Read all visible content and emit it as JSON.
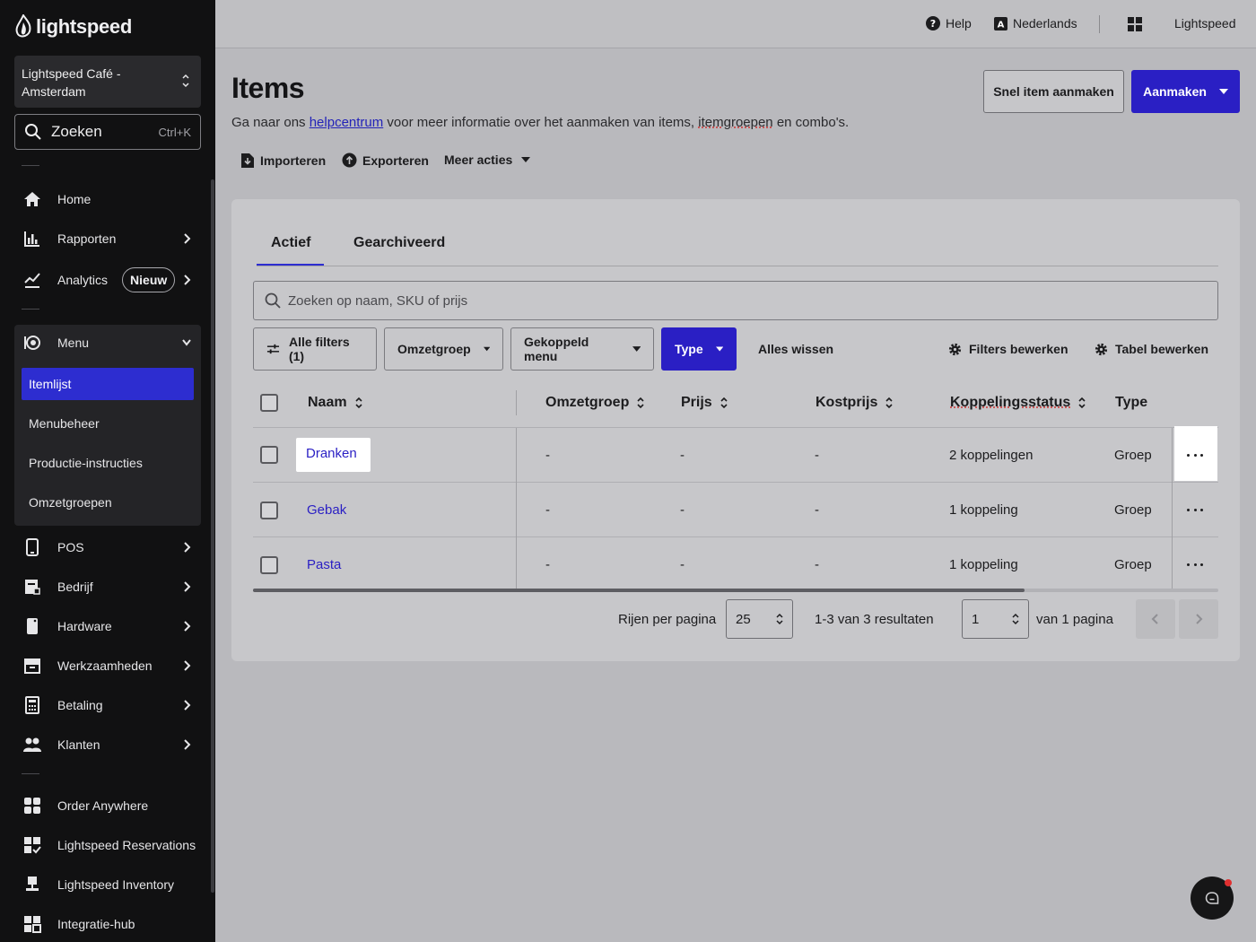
{
  "sidebar": {
    "brand": "lightspeed",
    "store": {
      "line1": "Lightspeed Café -",
      "line2": "Amsterdam"
    },
    "search": {
      "label": "Zoeken",
      "shortcut": "Ctrl+K"
    },
    "nav": {
      "home": "Home",
      "rapporten": "Rapporten",
      "analytics": "Analytics",
      "analytics_badge": "Nieuw",
      "menu": "Menu",
      "menu_items": [
        "Itemlijst",
        "Menubeheer",
        "Productie-instructies",
        "Omzetgroepen"
      ],
      "pos": "POS",
      "bedrijf": "Bedrijf",
      "hardware": "Hardware",
      "werkzaamheden": "Werkzaamheden",
      "betaling": "Betaling",
      "klanten": "Klanten",
      "order_anywhere": "Order Anywhere",
      "reservations": "Lightspeed Reservations",
      "inventory": "Lightspeed Inventory",
      "integratie": "Integratie-hub"
    },
    "active_item": "Itemlijst"
  },
  "topbar": {
    "help": "Help",
    "language": "Nederlands",
    "account": "Lightspeed"
  },
  "header": {
    "title": "Items",
    "subtitle_before": "Ga naar ons ",
    "subtitle_link": "helpcentrum",
    "subtitle_middle": " voor meer informatie over het aanmaken van items, ",
    "subtitle_groups": "itemgroepen",
    "subtitle_after": " en combo's.",
    "quick_create": "Snel item aanmaken",
    "create": "Aanmaken",
    "import": "Importeren",
    "export": "Exporteren",
    "more_actions": "Meer acties"
  },
  "tabs": {
    "active": "Actief",
    "archived": "Gearchiveerd"
  },
  "search": {
    "placeholder": "Zoeken op naam, SKU of prijs"
  },
  "filters": {
    "all": "Alle filters (1)",
    "revenue_group": "Omzetgroep",
    "linked_menu": "Gekoppeld menu",
    "type": "Type",
    "clear": "Alles wissen",
    "edit_filters": "Filters bewerken",
    "edit_table": "Tabel bewerken"
  },
  "table": {
    "columns": {
      "name": "Naam",
      "revenue_group": "Omzetgroep",
      "price": "Prijs",
      "cost": "Kostprijs",
      "link_status": "Koppelingsstatus",
      "type": "Type"
    },
    "rows": [
      {
        "name": "Dranken",
        "revenue_group": "-",
        "price": "-",
        "cost": "-",
        "link_status": "2 koppelingen",
        "type": "Groep"
      },
      {
        "name": "Gebak",
        "revenue_group": "-",
        "price": "-",
        "cost": "-",
        "link_status": "1 koppeling",
        "type": "Groep"
      },
      {
        "name": "Pasta",
        "revenue_group": "-",
        "price": "-",
        "cost": "-",
        "link_status": "1 koppeling",
        "type": "Groep"
      }
    ]
  },
  "pagination": {
    "rows_label": "Rijen per pagina",
    "rows_value": "25",
    "results": "1-3 van 3 resultaten",
    "page_value": "1",
    "of_pages": "van 1 pagina"
  },
  "colors": {
    "accent": "#2a1fc4",
    "sidebar_bg": "#111112",
    "active_nav": "#2d2dd0"
  }
}
